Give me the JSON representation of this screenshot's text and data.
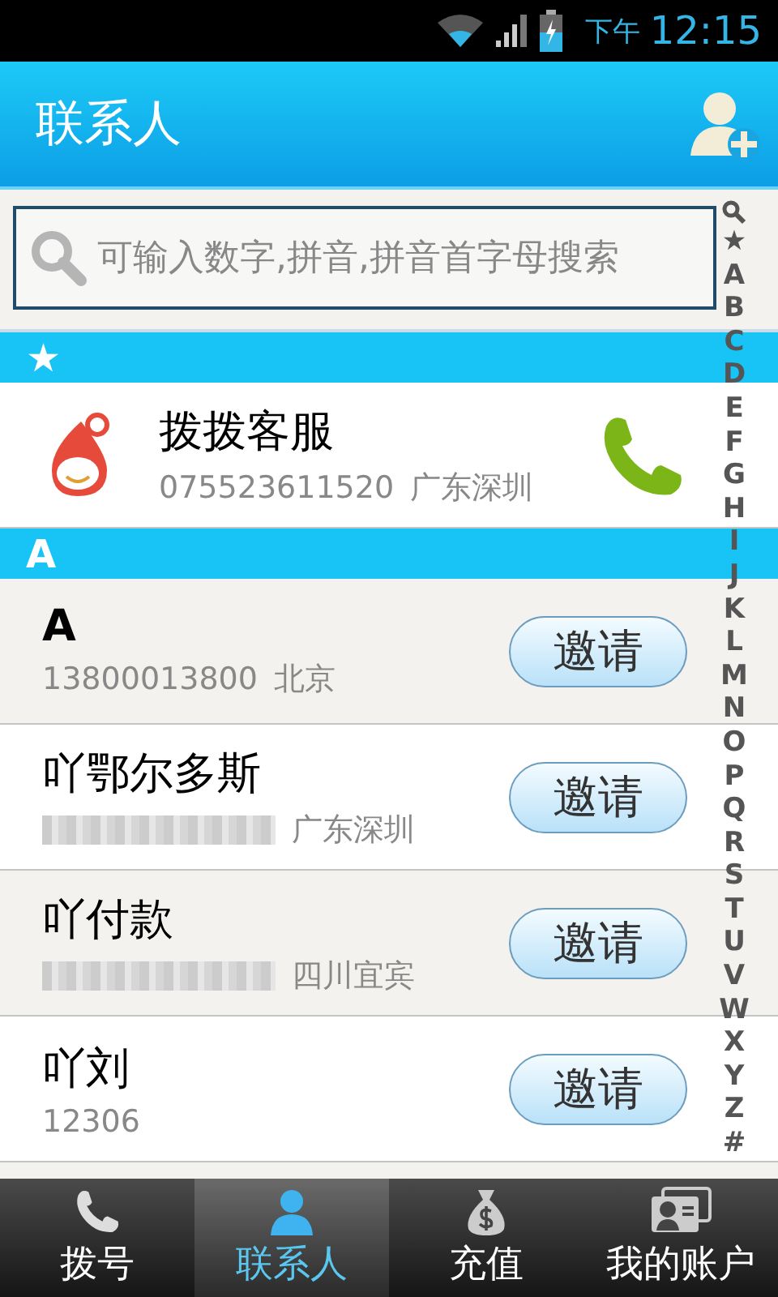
{
  "status_bar": {
    "period": "下午",
    "time": "12:15"
  },
  "header": {
    "title": "联系人"
  },
  "search": {
    "placeholder": "可输入数字,拼音,拼音首字母搜索"
  },
  "index": [
    "★",
    "A",
    "B",
    "C",
    "D",
    "E",
    "F",
    "G",
    "H",
    "I",
    "J",
    "K",
    "L",
    "M",
    "N",
    "O",
    "P",
    "Q",
    "R",
    "S",
    "T",
    "U",
    "V",
    "W",
    "X",
    "Y",
    "Z",
    "#"
  ],
  "sections": [
    {
      "header": "★",
      "contacts": [
        {
          "name": "拨拨客服",
          "bold": false,
          "number": "075523611520",
          "redacted": false,
          "location": "广东深圳",
          "kind": "call"
        }
      ]
    },
    {
      "header": "A",
      "contacts": [
        {
          "name": "A",
          "bold": true,
          "number": "13800013800",
          "redacted": false,
          "location": "北京",
          "kind": "invite",
          "button": "邀请"
        },
        {
          "name": "吖鄂尔多斯",
          "bold": false,
          "redacted": true,
          "location": "广东深圳",
          "kind": "invite",
          "button": "邀请"
        },
        {
          "name": "吖付款",
          "bold": false,
          "redacted": true,
          "location": "四川宜宾",
          "kind": "invite",
          "button": "邀请"
        },
        {
          "name": "吖刘",
          "bold": false,
          "number": "12306",
          "redacted": false,
          "kind": "invite",
          "button": "邀请"
        }
      ]
    }
  ],
  "tabs": [
    {
      "label": "拨号",
      "kind": "phone",
      "selected": false
    },
    {
      "label": "联系人",
      "kind": "person",
      "selected": true
    },
    {
      "label": "充值",
      "kind": "moneybag",
      "selected": false
    },
    {
      "label": "我的账户",
      "kind": "card",
      "selected": false
    }
  ]
}
